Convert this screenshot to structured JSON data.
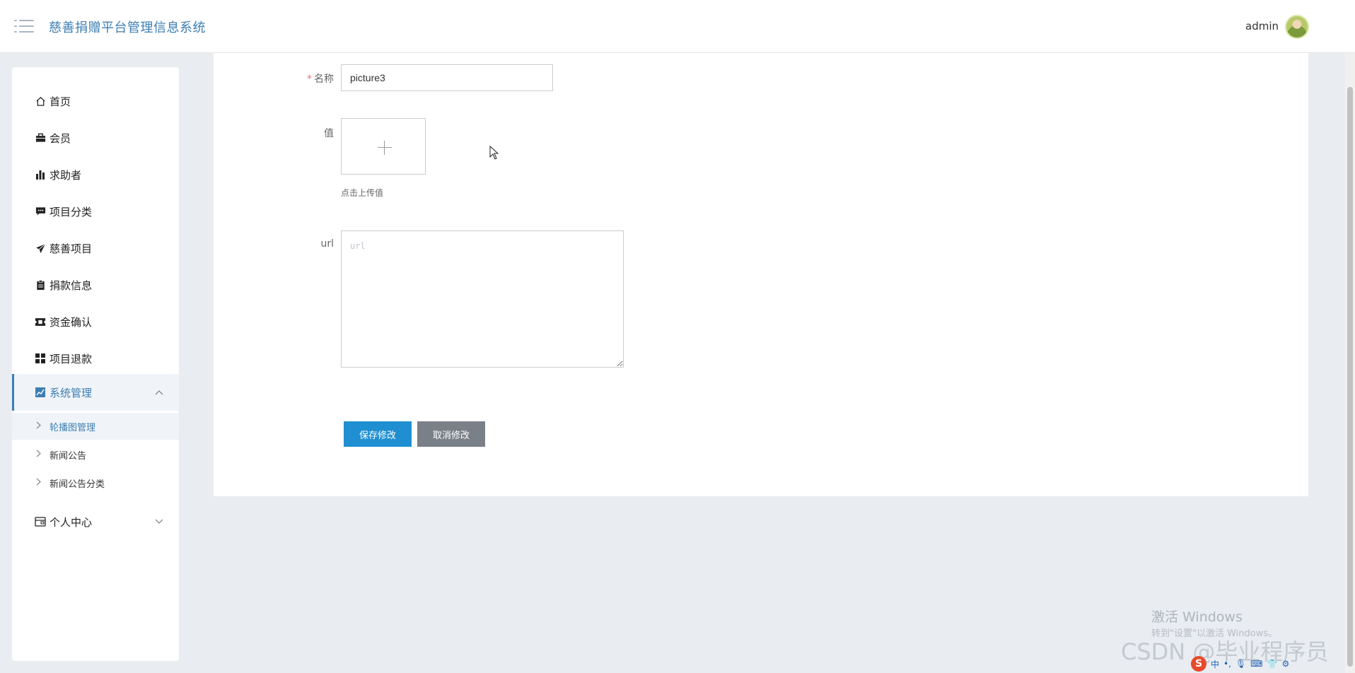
{
  "app": {
    "title": "慈善捐赠平台管理信息系统"
  },
  "header": {
    "user_name": "admin"
  },
  "sidebar": {
    "items": [
      {
        "label": "首页",
        "icon": "home-icon"
      },
      {
        "label": "会员",
        "icon": "briefcase-icon"
      },
      {
        "label": "求助者",
        "icon": "bar-chart-icon"
      },
      {
        "label": "项目分类",
        "icon": "comment-icon"
      },
      {
        "label": "慈善项目",
        "icon": "paper-plane-icon"
      },
      {
        "label": "捐款信息",
        "icon": "clipboard-icon"
      },
      {
        "label": "资金确认",
        "icon": "ticket-icon"
      },
      {
        "label": "项目退款",
        "icon": "grid-icon"
      },
      {
        "label": "系统管理",
        "icon": "line-chart-icon"
      }
    ],
    "sub_items": [
      {
        "label": "轮播图管理"
      },
      {
        "label": "新闻公告"
      },
      {
        "label": "新闻公告分类"
      }
    ],
    "personal": {
      "label": "个人中心",
      "icon": "wallet-icon"
    }
  },
  "form": {
    "name_label": "名称",
    "name_required_mark": "*",
    "name_value": "picture3",
    "value_label": "值",
    "upload_tip": "点击上传值",
    "url_label": "url",
    "url_placeholder": "url",
    "save_label": "保存修改",
    "cancel_label": "取消修改"
  },
  "overlay": {
    "windows_activation": "激活 Windows",
    "windows_activation_sub": "转到\"设置\"以激活 Windows。",
    "csdn_watermark": "CSDN @毕业程序员",
    "tray_text": "中"
  },
  "colors": {
    "accent": "#3d7eb2",
    "save": "#1f8fd1",
    "cancel": "#7a8088",
    "required": "#f56c6c"
  }
}
